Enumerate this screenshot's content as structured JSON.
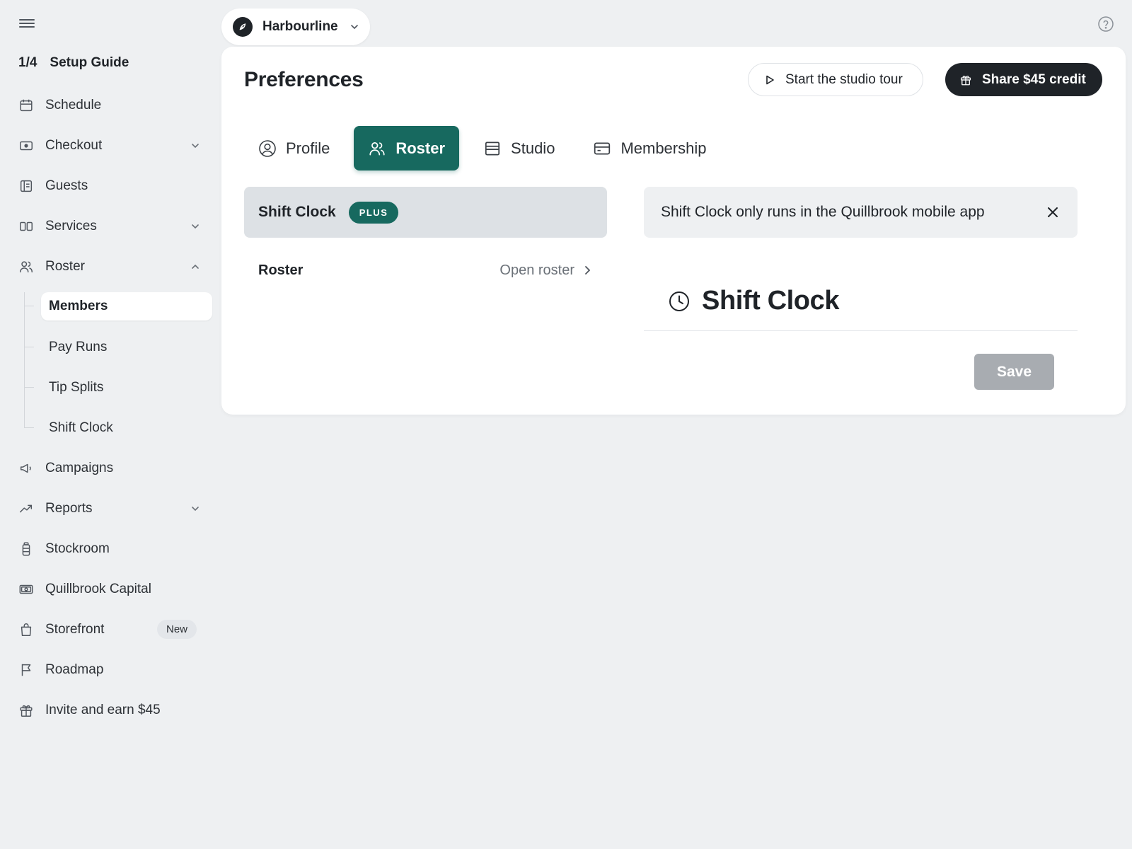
{
  "sidebar": {
    "setup_guide": {
      "progress": "1/4",
      "label": "Setup Guide"
    },
    "items": [
      {
        "label": "Schedule",
        "icon": "calendar-icon"
      },
      {
        "label": "Checkout",
        "icon": "register-icon",
        "expandable": true
      },
      {
        "label": "Guests",
        "icon": "contact-book-icon"
      },
      {
        "label": "Services",
        "icon": "services-icon",
        "expandable": true
      },
      {
        "label": "Roster",
        "icon": "users-icon",
        "expanded": true,
        "children": [
          "Members",
          "Pay Runs",
          "Tip Splits",
          "Shift Clock"
        ],
        "active_child": "Members"
      },
      {
        "label": "Campaigns",
        "icon": "megaphone-icon"
      },
      {
        "label": "Reports",
        "icon": "trend-up-icon",
        "expandable": true
      },
      {
        "label": "Stockroom",
        "icon": "bottle-icon"
      },
      {
        "label": "Quillbrook Capital",
        "icon": "banknote-icon"
      },
      {
        "label": "Storefront",
        "icon": "shopping-bag-icon",
        "badge": "New"
      },
      {
        "label": "Roadmap",
        "icon": "flag-icon"
      },
      {
        "label": "Invite and earn $45",
        "icon": "gift-icon"
      }
    ]
  },
  "topbar": {
    "org_name": "Harbourline",
    "help_icon": "help-circle-icon"
  },
  "page": {
    "title": "Preferences",
    "tour_button": "Start the studio tour",
    "share_button": "Share $45 credit",
    "tabs": [
      {
        "label": "Profile",
        "icon": "user-circle-icon"
      },
      {
        "label": "Roster",
        "icon": "users-icon",
        "active": true
      },
      {
        "label": "Studio",
        "icon": "storefront-icon"
      },
      {
        "label": "Membership",
        "icon": "credit-card-icon"
      }
    ],
    "feature": {
      "title": "Shift Clock",
      "badge": "PLUS"
    },
    "roster_row": {
      "label": "Roster",
      "link": "Open roster"
    },
    "notice": "Shift Clock only runs in the Quillbrook mobile app",
    "section_title": "Shift Clock",
    "save_button": "Save"
  },
  "colors": {
    "accent": "#17695f",
    "dark": "#1f2328",
    "background": "#eef0f2",
    "disabled": "#a8acb1"
  }
}
